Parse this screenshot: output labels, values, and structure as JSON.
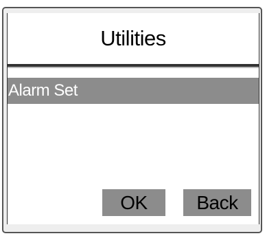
{
  "screen": {
    "title": "Utilities"
  },
  "menu": {
    "items": [
      {
        "label": "Alarm Set",
        "selected": true
      }
    ]
  },
  "buttons": {
    "ok_label": "OK",
    "back_label": "Back"
  },
  "colors": {
    "highlight": "#8c8c8c",
    "frame": "#555555",
    "background": "#ffffff"
  }
}
